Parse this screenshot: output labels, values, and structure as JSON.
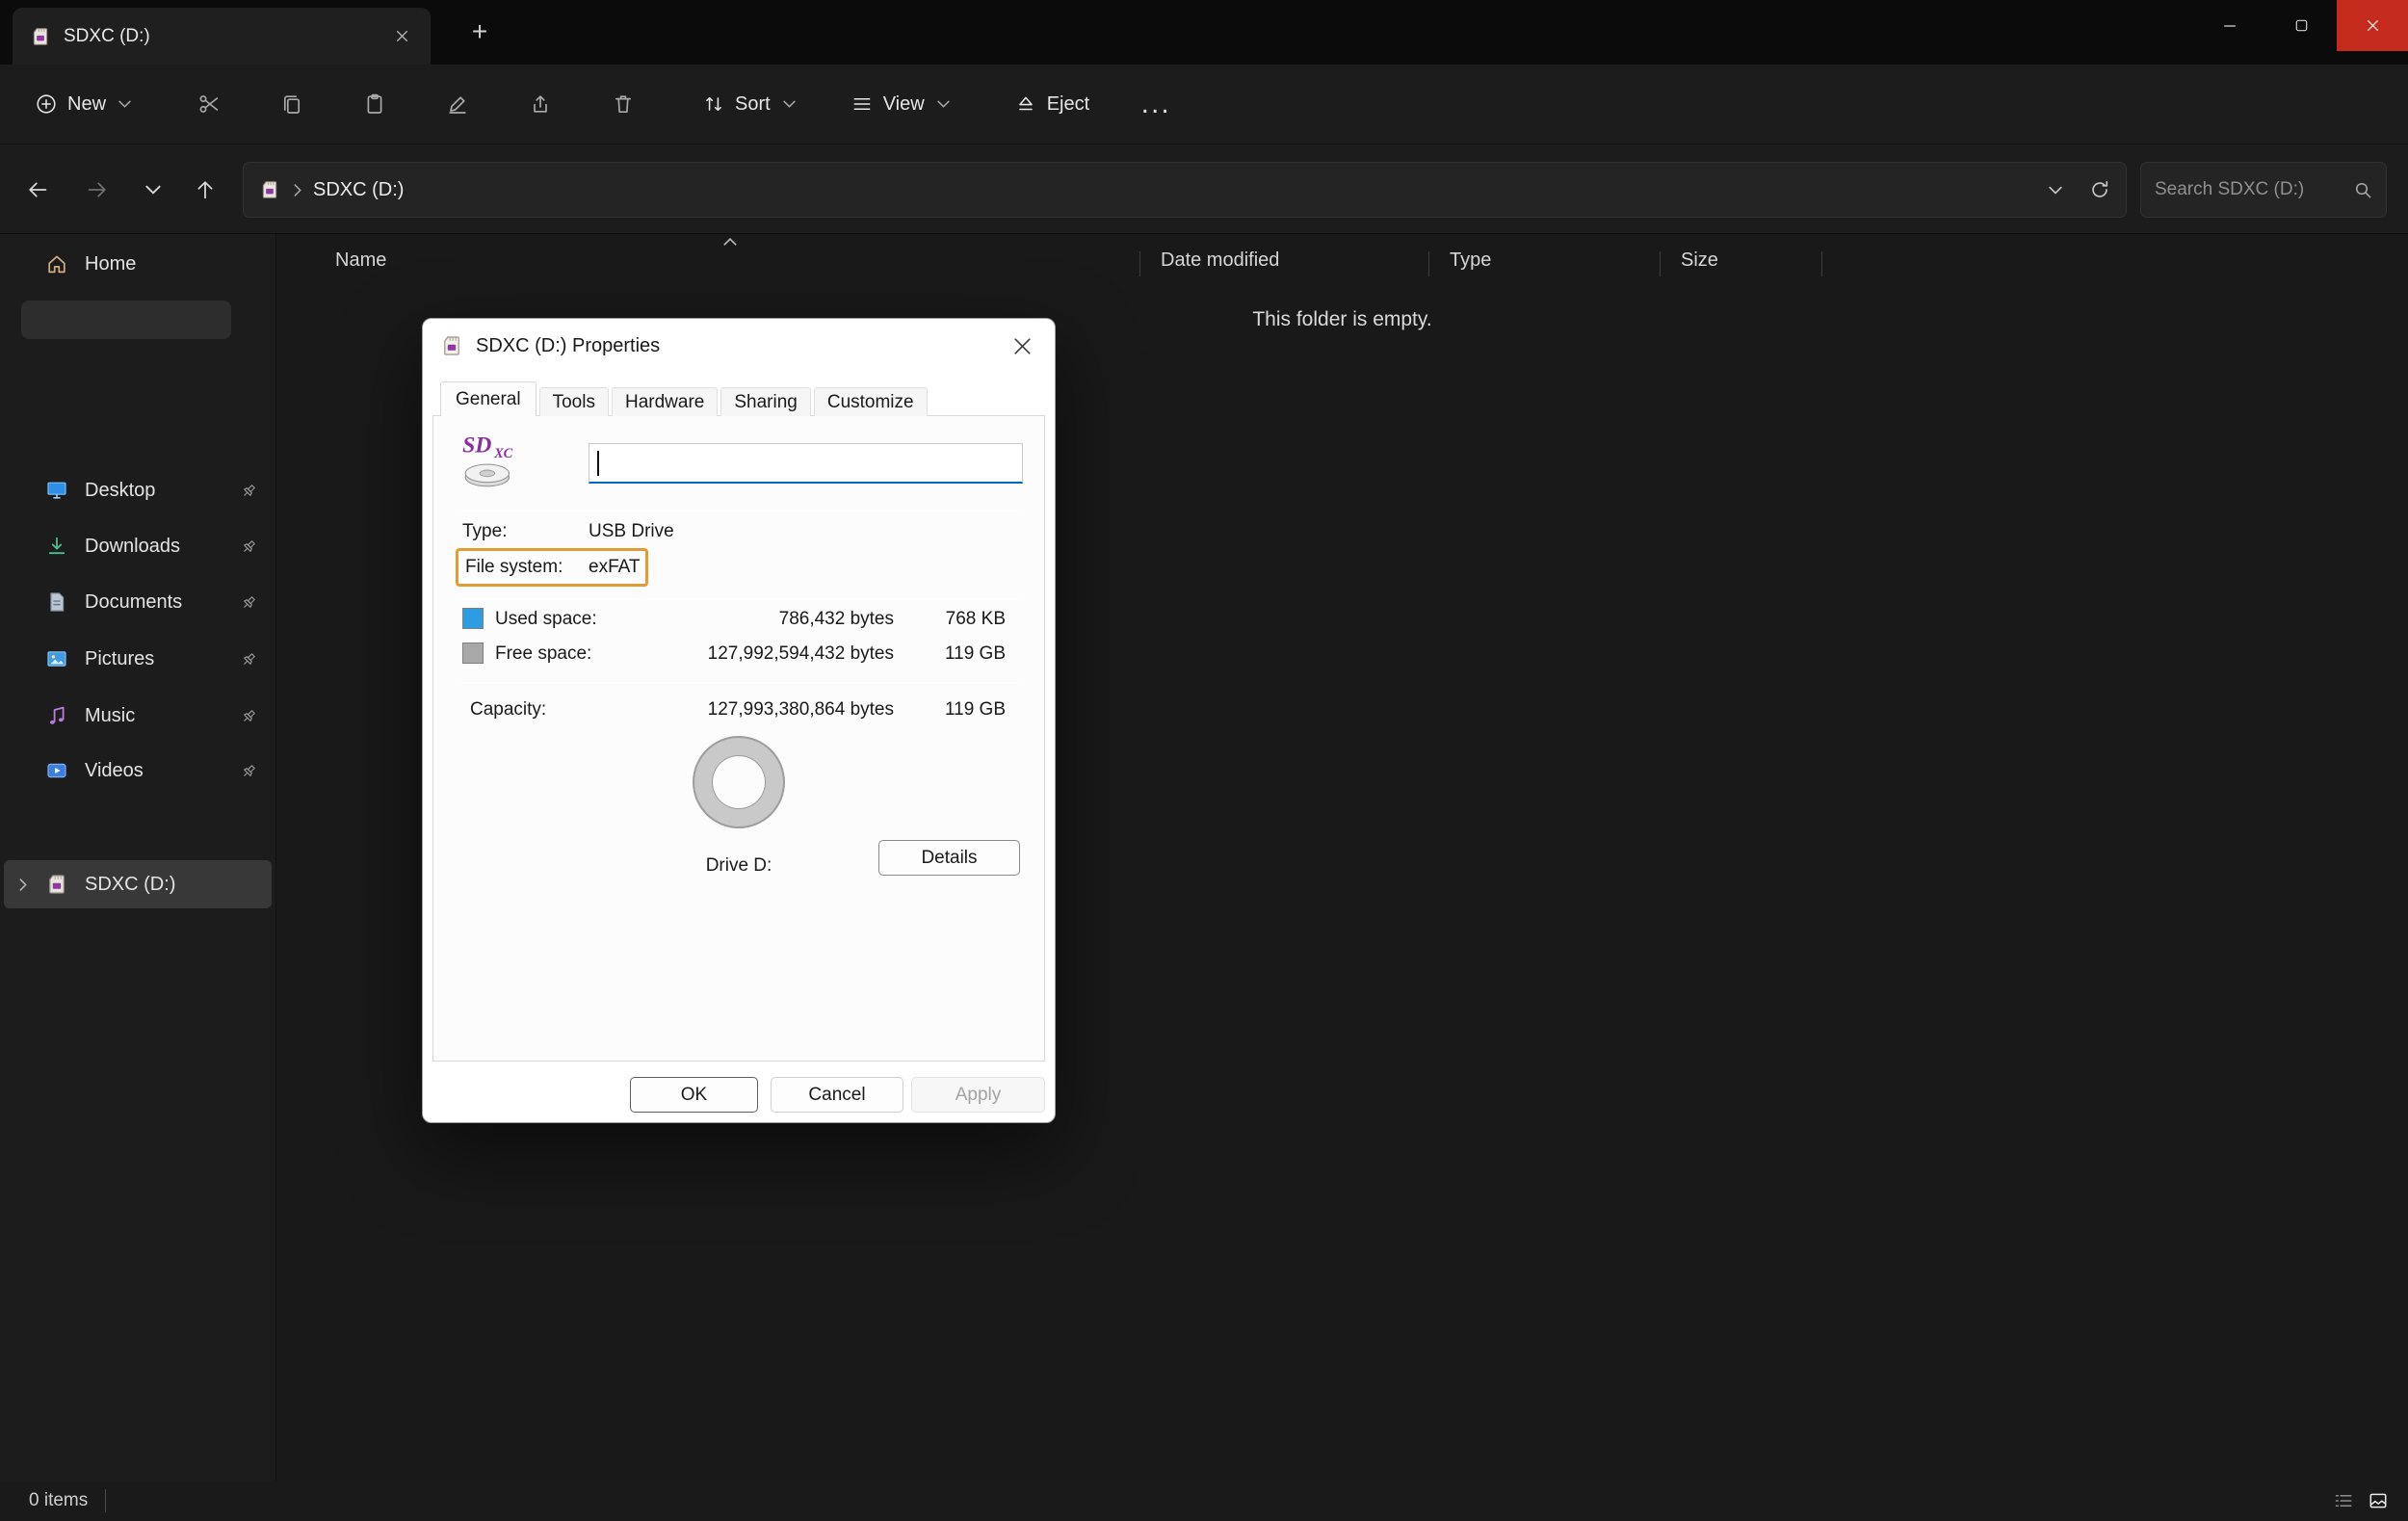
{
  "window": {
    "tab_title": "SDXC (D:)"
  },
  "icons": {
    "new_tab": "+",
    "more": "..."
  },
  "colors": {
    "accent_blue": "#0067c0",
    "close_red": "#c42b1c",
    "highlight_orange": "#e39b35"
  },
  "toolbar": {
    "new_label": "New",
    "sort_label": "Sort",
    "view_label": "View",
    "eject_label": "Eject"
  },
  "address": {
    "crumb": "SDXC (D:)",
    "search_placeholder": "Search SDXC (D:)"
  },
  "sidebar": {
    "home": {
      "label": "Home"
    },
    "pinned": [
      {
        "label": "Desktop"
      },
      {
        "label": "Downloads"
      },
      {
        "label": "Documents"
      },
      {
        "label": "Pictures"
      },
      {
        "label": "Music"
      },
      {
        "label": "Videos"
      }
    ],
    "drive": {
      "label": "SDXC (D:)"
    }
  },
  "main": {
    "columns": [
      "Name",
      "Date modified",
      "Type",
      "Size"
    ],
    "empty_text": "This folder is empty."
  },
  "status": {
    "items_count": "0 items"
  },
  "dialog": {
    "title": "SDXC (D:) Properties",
    "tabs": [
      "General",
      "Tools",
      "Hardware",
      "Sharing",
      "Customize"
    ],
    "label_value": "",
    "type_label": "Type:",
    "type_value": "USB Drive",
    "fs_label": "File system:",
    "fs_value": "exFAT",
    "used": {
      "label": "Used space:",
      "bytes": "786,432 bytes",
      "size": "768 KB",
      "color": "#2d9ce0"
    },
    "free": {
      "label": "Free space:",
      "bytes": "127,992,594,432 bytes",
      "size": "119 GB",
      "color": "#a8a8a8"
    },
    "capacity": {
      "label": "Capacity:",
      "bytes": "127,993,380,864 bytes",
      "size": "119 GB"
    },
    "drive_label": "Drive D:",
    "details_button": "Details",
    "buttons": {
      "ok": "OK",
      "cancel": "Cancel",
      "apply": "Apply"
    }
  }
}
